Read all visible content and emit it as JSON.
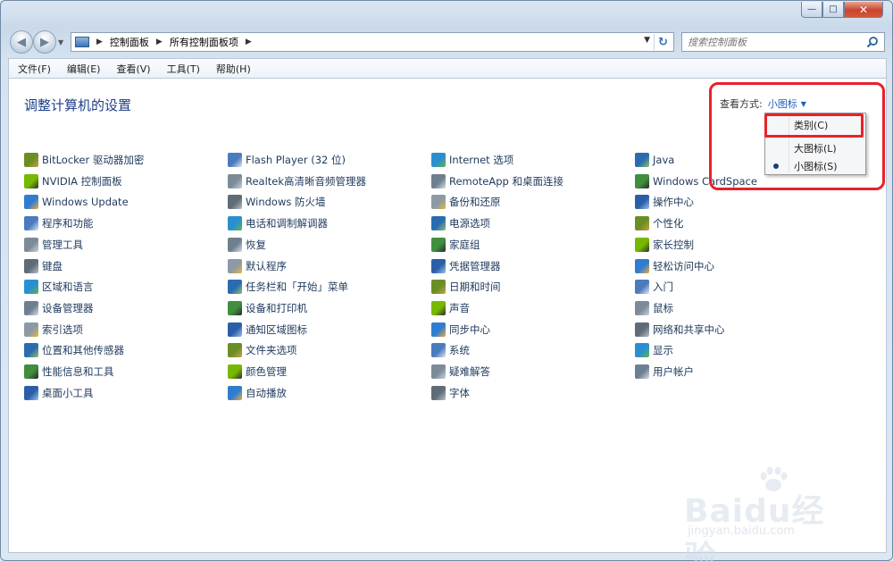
{
  "window": {
    "minimize_glyph": "—",
    "maximize_glyph": "□",
    "close_glyph": "✕"
  },
  "navigation": {
    "breadcrumb": [
      "控制面板",
      "所有控制面板项"
    ],
    "search_placeholder": "搜索控制面板"
  },
  "menubar": [
    "文件(F)",
    "编辑(E)",
    "查看(V)",
    "工具(T)",
    "帮助(H)"
  ],
  "page": {
    "title": "调整计算机的设置",
    "view_by_label": "查看方式:",
    "view_by_value": "小图标"
  },
  "view_menu": {
    "items": [
      {
        "label": "类别(C)",
        "selected": false
      },
      {
        "label": "大图标(L)",
        "selected": false
      },
      {
        "label": "小图标(S)",
        "selected": true
      }
    ]
  },
  "control_panel_items": {
    "col1": [
      "BitLocker 驱动器加密",
      "NVIDIA 控制面板",
      "Windows Update",
      "程序和功能",
      "管理工具",
      "键盘",
      "区域和语言",
      "设备管理器",
      "索引选项",
      "位置和其他传感器",
      "性能信息和工具",
      "桌面小工具"
    ],
    "col2": [
      "Flash Player (32 位)",
      "Realtek高清晰音频管理器",
      "Windows 防火墙",
      "电话和调制解调器",
      "恢复",
      "默认程序",
      "任务栏和「开始」菜单",
      "设备和打印机",
      "通知区域图标",
      "文件夹选项",
      "颜色管理",
      "自动播放"
    ],
    "col3": [
      "Internet 选项",
      "RemoteApp 和桌面连接",
      "备份和还原",
      "电源选项",
      "家庭组",
      "凭据管理器",
      "日期和时间",
      "声音",
      "同步中心",
      "系统",
      "疑难解答",
      "字体"
    ],
    "col4": [
      "Java",
      "Windows CardSpace",
      "操作中心",
      "个性化",
      "家长控制",
      "轻松访问中心",
      "入门",
      "鼠标",
      "网络和共享中心",
      "显示",
      "用户帐户"
    ]
  },
  "watermark": {
    "brand": "Bai",
    "brand2": "du",
    "product": "经验",
    "url": "jingyan.baidu.com"
  }
}
